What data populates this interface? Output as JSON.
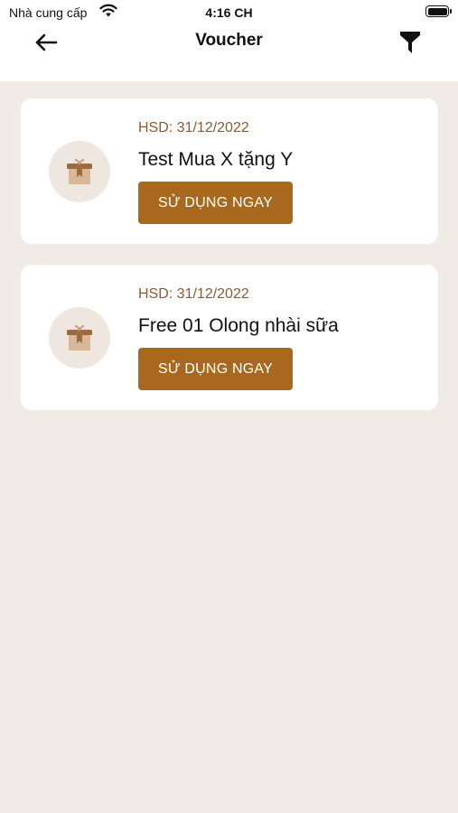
{
  "status_bar": {
    "carrier": "Nhà cung cấp",
    "time": "4:16 CH"
  },
  "nav": {
    "title": "Voucher",
    "back_icon": "arrow-left-icon",
    "filter_icon": "filter-icon"
  },
  "vouchers": [
    {
      "expiry": "HSD: 31/12/2022",
      "title": "Test Mua X tặng Y",
      "button_label": "SỬ DỤNG NGAY",
      "icon": "gift-box-icon"
    },
    {
      "expiry": "HSD: 31/12/2022",
      "title": "Free 01 Olong nhài sữa",
      "button_label": "SỬ DỤNG NGAY",
      "icon": "gift-box-icon"
    }
  ],
  "colors": {
    "background": "#f0ebe5",
    "accent_button": "#a8691f",
    "expiry_text": "#8a5a35",
    "icon_circle": "#efe7df"
  }
}
